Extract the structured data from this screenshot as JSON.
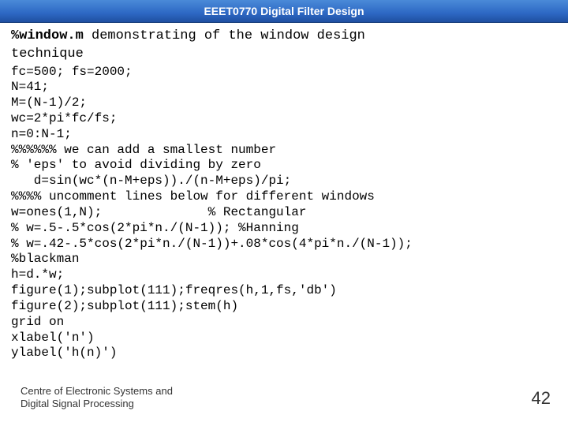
{
  "header": {
    "title": "EEET0770 Digital Filter Design"
  },
  "slide": {
    "file_name": "%window.m",
    "title_rest": "  demonstrating of the window design",
    "title_line2": "technique",
    "code_lines": [
      "fc=500; fs=2000;",
      "N=41;",
      "M=(N-1)/2;",
      "wc=2*pi*fc/fs;",
      "n=0:N-1;",
      "%%%%%% we can add a smallest number",
      "% 'eps' to avoid dividing by zero",
      "   d=sin(wc*(n-M+eps))./(n-M+eps)/pi;",
      "%%%% uncomment lines below for different windows",
      "w=ones(1,N);              % Rectangular",
      "% w=.5-.5*cos(2*pi*n./(N-1)); %Hanning",
      "% w=.42-.5*cos(2*pi*n./(N-1))+.08*cos(4*pi*n./(N-1));",
      "%blackman",
      "h=d.*w;",
      "figure(1);subplot(111);freqres(h,1,fs,'db')",
      "figure(2);subplot(111);stem(h)",
      "grid on",
      "xlabel('n')",
      "ylabel('h(n)')"
    ]
  },
  "footer": {
    "line1": "Centre of Electronic Systems and",
    "line2": "Digital Signal Processing"
  },
  "page_number": "42"
}
